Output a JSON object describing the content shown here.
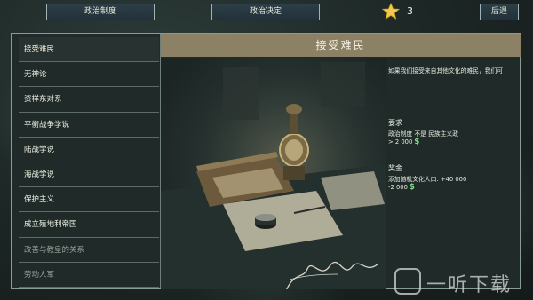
{
  "topbar": {
    "policies_label": "政治制度",
    "decisions_label": "政治决定",
    "star_count": "3",
    "back_label": "后退"
  },
  "list": {
    "items": [
      {
        "label": "接受难民",
        "state": "active"
      },
      {
        "label": "无神论",
        "state": "normal"
      },
      {
        "label": "资样东对系",
        "state": "normal"
      },
      {
        "label": "平衡战争学说",
        "state": "normal"
      },
      {
        "label": "陆战学说",
        "state": "normal"
      },
      {
        "label": "海战学说",
        "state": "normal"
      },
      {
        "label": "保护主义",
        "state": "normal"
      },
      {
        "label": "成立殖地利帝国",
        "state": "normal"
      },
      {
        "label": "改善与教皇的关系",
        "state": "dim"
      },
      {
        "label": "劳动人军",
        "state": "dim"
      }
    ]
  },
  "detail": {
    "title": "接受难民",
    "description": "如果我们接受来自其他文化的难民，我们可",
    "requirements_title": "要求",
    "requirement_line": "政治制度 不是 民族主义政",
    "requirement_cost": "> 2 000",
    "rewards_title": "奖金",
    "reward_line": "添加随机文化人口: +40 000",
    "reward_cost": "-2 000"
  },
  "colors": {
    "money": "#7fe08a",
    "title_bar": "#8d8165",
    "star": "#f2c94c"
  },
  "icons": [
    "star-icon",
    "money-icon"
  ],
  "watermark": {
    "text": "一听下载"
  }
}
